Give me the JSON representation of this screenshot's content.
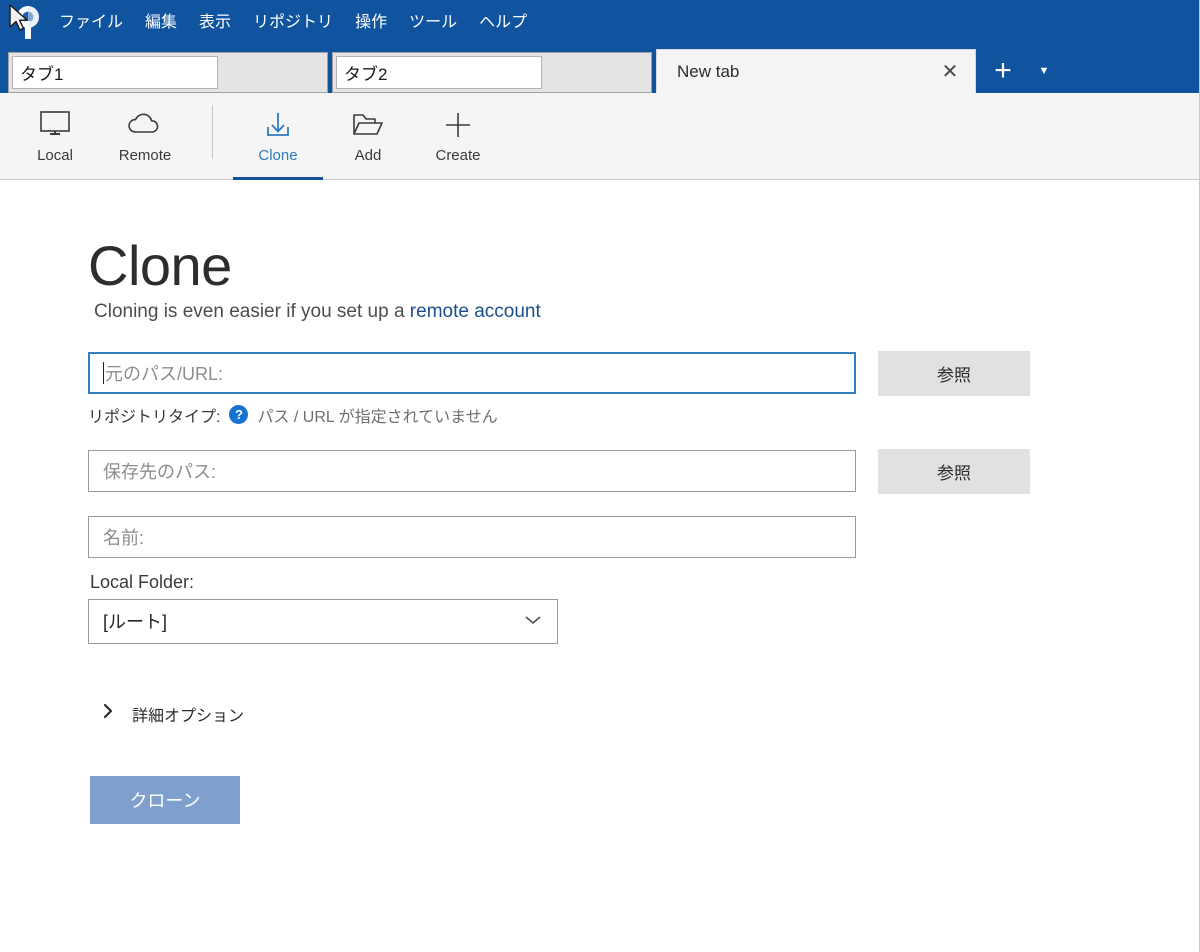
{
  "window": {
    "logo_icon": "sourcetree-logo-icon",
    "cursor_icon": "mouse-cursor-icon",
    "titlebar_color": "#10539f"
  },
  "menubar": {
    "items": [
      {
        "label": "ファイル",
        "name": "menu-file"
      },
      {
        "label": "編集",
        "name": "menu-edit"
      },
      {
        "label": "表示",
        "name": "menu-view"
      },
      {
        "label": "リポジトリ",
        "name": "menu-repository"
      },
      {
        "label": "操作",
        "name": "menu-actions"
      },
      {
        "label": "ツール",
        "name": "menu-tools"
      },
      {
        "label": "ヘルプ",
        "name": "menu-help"
      }
    ]
  },
  "tabs": {
    "items": [
      {
        "label": "タブ1",
        "active": false
      },
      {
        "label": "タブ2",
        "active": false
      },
      {
        "label": "New tab",
        "active": true
      }
    ],
    "close_icon": "✕",
    "new_tab_icon": "+",
    "tab_list_icon": "▼"
  },
  "toolbar": {
    "buttons": [
      {
        "label": "Local",
        "icon": "monitor-icon",
        "active": false
      },
      {
        "label": "Remote",
        "icon": "cloud-icon",
        "active": false
      },
      {
        "label": "Clone",
        "icon": "download-arrow-icon",
        "active": true
      },
      {
        "label": "Add",
        "icon": "open-folder-icon",
        "active": false
      },
      {
        "label": "Create",
        "icon": "plus-icon",
        "active": false
      }
    ],
    "active_color": "#2e7bbd",
    "underline_color": "#12529c"
  },
  "main": {
    "title": "Clone",
    "subtitle_prefix": "Cloning is even easier if you set up a ",
    "subtitle_link": "remote account",
    "source": {
      "placeholder": "元のパス/URL:",
      "value": "",
      "browse_label": "参照"
    },
    "repo_type": {
      "label": "リポジトリタイプ:",
      "help_icon": "?",
      "value": "パス / URL が指定されていません"
    },
    "destination": {
      "placeholder": "保存先のパス:",
      "value": "",
      "browse_label": "参照"
    },
    "name_field": {
      "placeholder": "名前:",
      "value": ""
    },
    "local_folder": {
      "label": "Local Folder:",
      "selected": "[ルート]",
      "chevron_icon": "⌄"
    },
    "advanced": {
      "label": "詳細オプション",
      "chevron_icon": "❯"
    },
    "clone_button": {
      "label": "クローン",
      "color": "#7f9fce",
      "enabled": false
    }
  }
}
